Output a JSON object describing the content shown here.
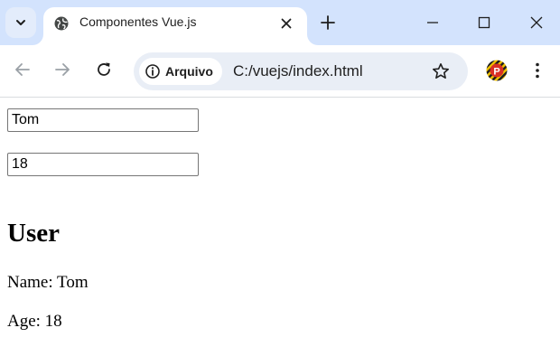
{
  "browser": {
    "tab": {
      "title": "Componentes Vue.js",
      "favicon": "globe-icon"
    },
    "address_bar": {
      "security_label": "Arquivo",
      "url": "C:/vuejs/index.html"
    },
    "profile": {
      "initial": "P"
    },
    "accent_color": "#d3e3fd"
  },
  "page": {
    "inputs": {
      "name_value": "Tom",
      "age_value": "18"
    },
    "user_card": {
      "heading": "User",
      "name_line": "Name: Tom",
      "age_line": "Age: 18"
    }
  }
}
